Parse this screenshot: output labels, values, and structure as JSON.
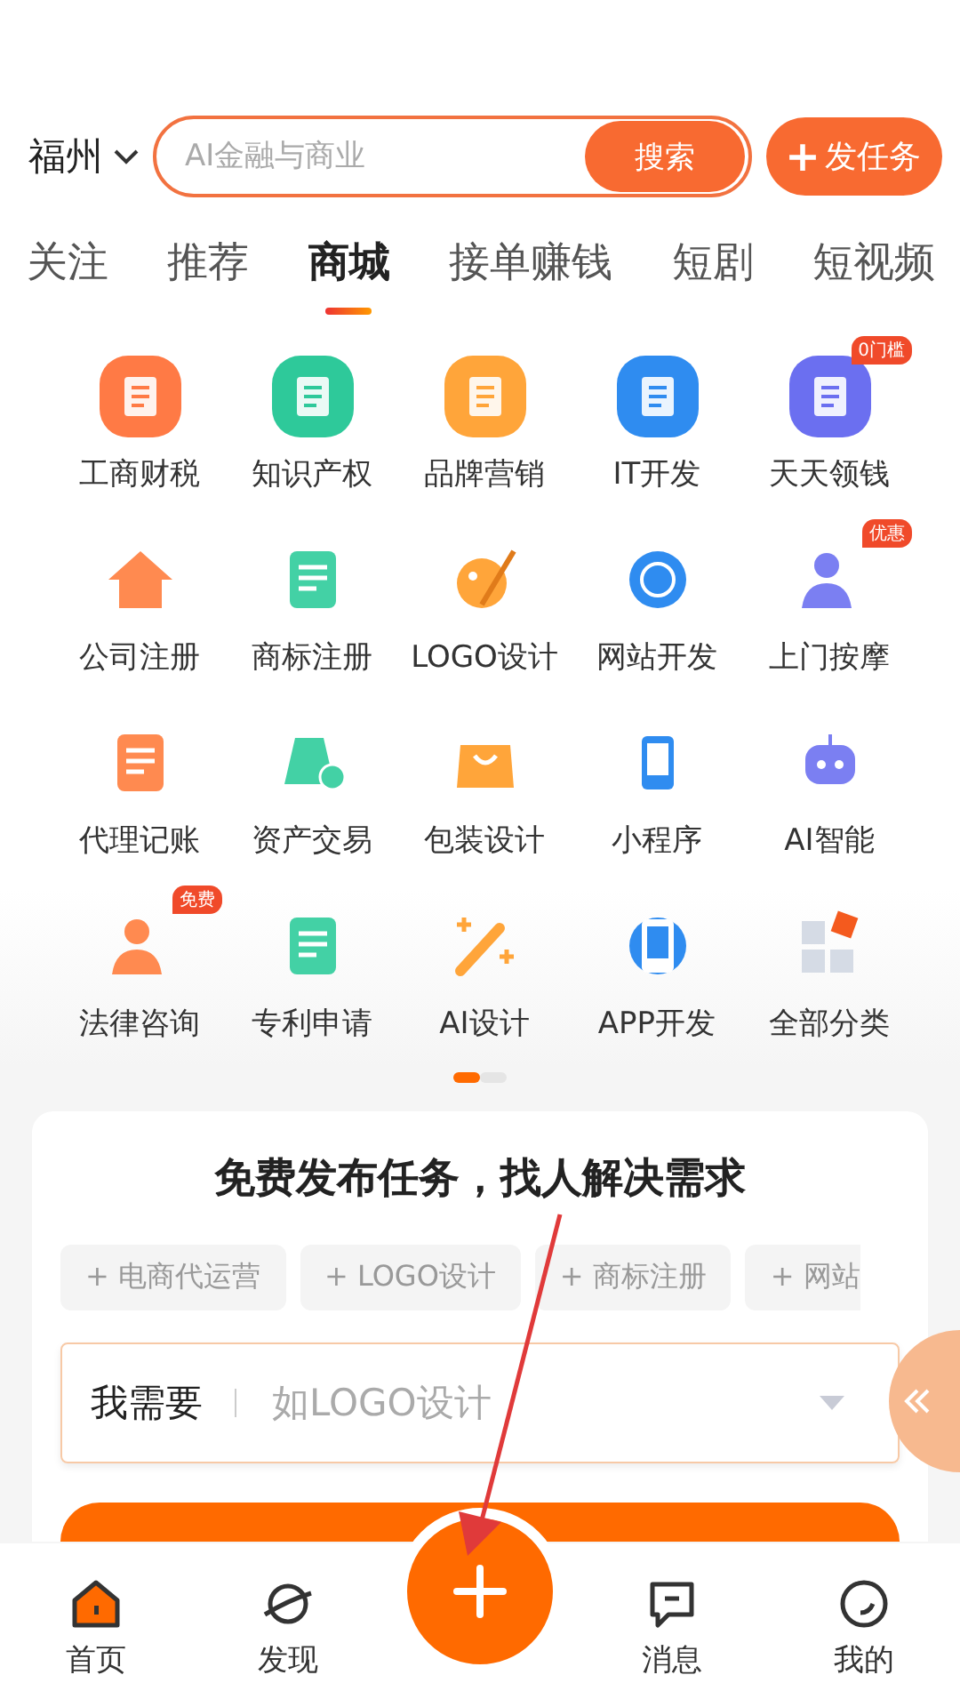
{
  "header": {
    "city": "福州",
    "search": {
      "placeholder": "AI金融与商业",
      "button": "搜索"
    },
    "post_button": "发任务"
  },
  "tabs": [
    {
      "label": "关注",
      "selected": false
    },
    {
      "label": "推荐",
      "selected": false
    },
    {
      "label": "商城",
      "selected": true
    },
    {
      "label": "接单赚钱",
      "selected": false
    },
    {
      "label": "短剧",
      "selected": false
    },
    {
      "label": "短视频",
      "selected": false
    }
  ],
  "categories": [
    {
      "label": "工商财税"
    },
    {
      "label": "知识产权"
    },
    {
      "label": "品牌营销"
    },
    {
      "label": "IT开发"
    },
    {
      "label": "天天领钱",
      "badge": "0门槛"
    },
    {
      "label": "公司注册"
    },
    {
      "label": "商标注册"
    },
    {
      "label": "LOGO设计"
    },
    {
      "label": "网站开发"
    },
    {
      "label": "上门按摩",
      "badge": "优惠"
    },
    {
      "label": "代理记账"
    },
    {
      "label": "资产交易"
    },
    {
      "label": "包装设计"
    },
    {
      "label": "小程序"
    },
    {
      "label": "AI智能"
    },
    {
      "label": "法律咨询",
      "badge": "免费"
    },
    {
      "label": "专利申请"
    },
    {
      "label": "AI设计"
    },
    {
      "label": "APP开发"
    },
    {
      "label": "全部分类"
    }
  ],
  "pager": [
    {
      "selected": true
    },
    {
      "selected": false
    }
  ],
  "task_card": {
    "title": "免费发布任务，找人解决需求",
    "tags": [
      "+ 电商代运营",
      "+ LOGO设计",
      "+ 商标注册",
      "+ 网站"
    ],
    "need_field": {
      "label": "我需要",
      "placeholder": "如LOGO设计"
    }
  },
  "bottom_nav": [
    {
      "label": "首页",
      "selected": true
    },
    {
      "label": "发现",
      "selected": false
    },
    {
      "label": "消息",
      "selected": false
    },
    {
      "label": "我的",
      "selected": false
    }
  ]
}
